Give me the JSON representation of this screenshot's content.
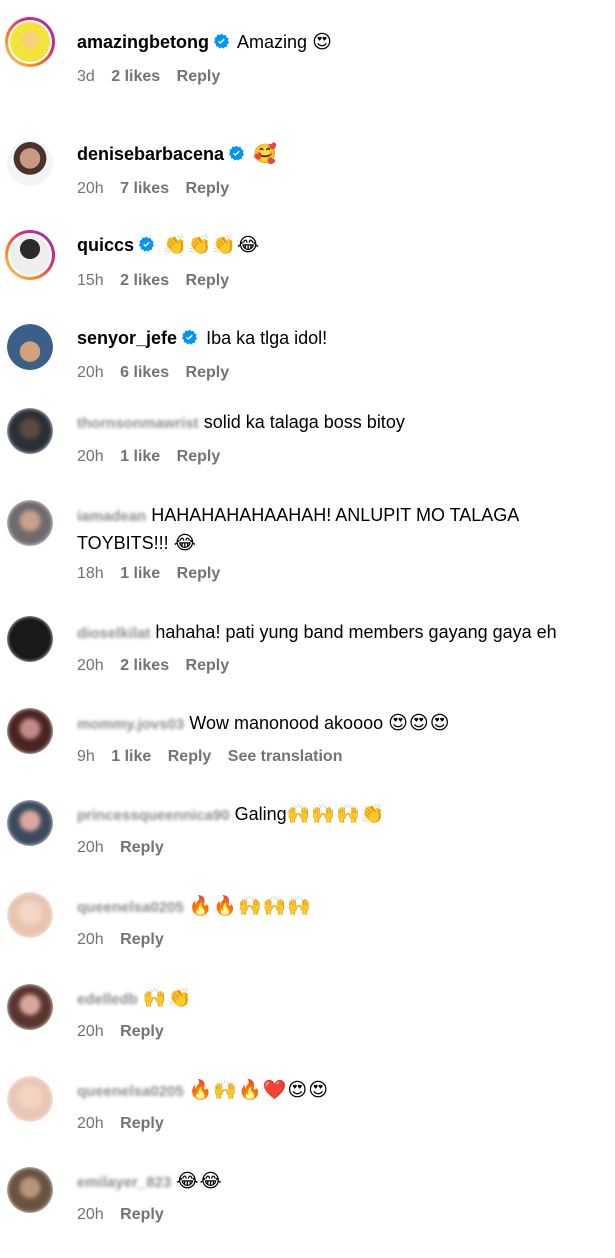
{
  "comments": [
    {
      "username": "amazingbetong",
      "verified": true,
      "text": "Amazing",
      "emoji": "😍",
      "time": "3d",
      "likes": "2 likes",
      "reply": "Reply",
      "translate": ""
    },
    {
      "username": "denisebarbacena",
      "verified": true,
      "text": "",
      "emoji": "🥰",
      "time": "20h",
      "likes": "7 likes",
      "reply": "Reply",
      "translate": ""
    },
    {
      "username": "quiccs",
      "verified": true,
      "text": "",
      "emoji": "👏👏👏😂",
      "time": "15h",
      "likes": "2 likes",
      "reply": "Reply",
      "translate": ""
    },
    {
      "username": "senyor_jefe",
      "verified": true,
      "text": "Iba ka tlga idol!",
      "emoji": "",
      "time": "20h",
      "likes": "6 likes",
      "reply": "Reply",
      "translate": ""
    },
    {
      "username": "thornsonmawrist",
      "verified": false,
      "text": "solid ka talaga boss bitoy",
      "emoji": "",
      "time": "20h",
      "likes": "1 like",
      "reply": "Reply",
      "translate": ""
    },
    {
      "username": "iamadean",
      "verified": false,
      "text": "HAHAHAHAHAAHAH! ANLUPIT MO TALAGA TOYBITS!!!",
      "emoji": "😂",
      "time": "18h",
      "likes": "1 like",
      "reply": "Reply",
      "translate": ""
    },
    {
      "username": "dioselkilat",
      "verified": false,
      "text": "hahaha! pati yung band members gayang gaya eh",
      "emoji": "",
      "time": "20h",
      "likes": "2 likes",
      "reply": "Reply",
      "translate": ""
    },
    {
      "username": "mommy.jovs03",
      "verified": false,
      "text": "Wow manonood akoooo",
      "emoji": "😍😍😍",
      "time": "9h",
      "likes": "1 like",
      "reply": "Reply",
      "translate": "See translation"
    },
    {
      "username": "princessqueennica90",
      "verified": false,
      "text": "Galing",
      "emoji": "🙌🙌🙌👏",
      "time": "20h",
      "likes": "",
      "reply": "Reply",
      "translate": ""
    },
    {
      "username": "queenelsa0205",
      "verified": false,
      "text": "",
      "emoji": "🔥🔥🙌🙌🙌",
      "time": "20h",
      "likes": "",
      "reply": "Reply",
      "translate": ""
    },
    {
      "username": "edelledb",
      "verified": false,
      "text": "",
      "emoji": "🙌👏",
      "time": "20h",
      "likes": "",
      "reply": "Reply",
      "translate": ""
    },
    {
      "username": "queenelsa0205",
      "verified": false,
      "text": "",
      "emoji": "🔥🙌🔥❤️😍😍",
      "time": "20h",
      "likes": "",
      "reply": "Reply",
      "translate": ""
    },
    {
      "username": "emilayer_823",
      "verified": false,
      "text": "",
      "emoji": "😂😂",
      "time": "20h",
      "likes": "",
      "reply": "Reply",
      "translate": ""
    }
  ],
  "colors": {
    "verified": "#0095f6",
    "meta": "#737373",
    "blurred_username": "#8e8e8e"
  }
}
